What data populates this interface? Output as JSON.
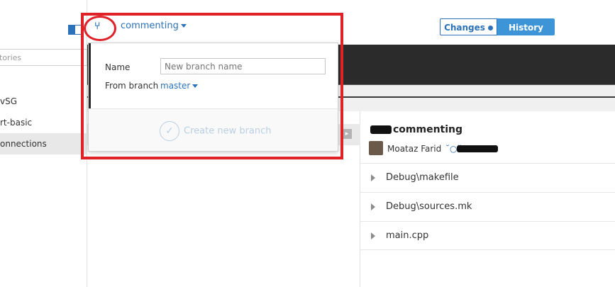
{
  "sidebar": {
    "filter_placeholder": "tories",
    "repos": [
      {
        "label": "vSG",
        "selected": false
      },
      {
        "label": "rt-basic",
        "selected": false
      },
      {
        "label": "onnections",
        "selected": true
      }
    ]
  },
  "toolbar": {
    "branch_icon": "branch-icon",
    "branch_name": "commenting",
    "changes_label": "Changes",
    "history_label": "History"
  },
  "popover": {
    "name_label": "Name",
    "name_placeholder": "New branch name",
    "from_label": "From branch",
    "from_value": "master",
    "create_label": "Create new branch"
  },
  "commit": {
    "title": "commenting",
    "author": "Moataz Farid"
  },
  "files": [
    {
      "name": "Debug\\makefile"
    },
    {
      "name": "Debug\\sources.mk"
    },
    {
      "name": "main.cpp"
    }
  ],
  "colors": {
    "accent": "#2b72b8",
    "history_bg": "#3d95d8",
    "annotation": "#e12128"
  }
}
